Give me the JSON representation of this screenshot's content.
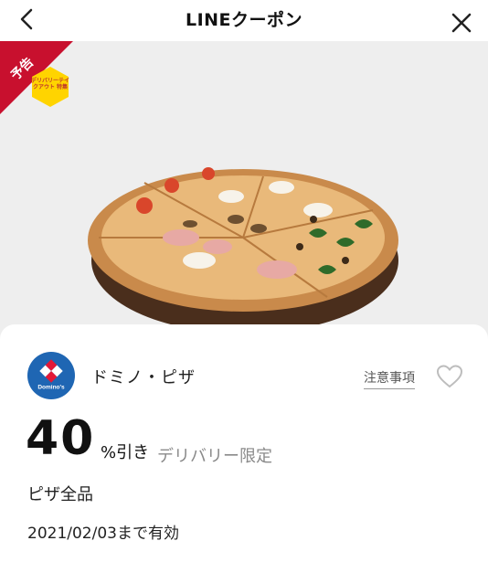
{
  "header": {
    "title": "LINEクーポン"
  },
  "hero": {
    "ribbon_label": "予告",
    "badge_label": "デリバリーテイクアウト 特集"
  },
  "coupon": {
    "merchant": "ドミノ・ピザ",
    "notes_link": "注意事項",
    "discount_value": "40",
    "discount_unit": "%引き",
    "discount_scope": "デリバリー限定",
    "target": "ピザ全品",
    "validity": "2021/02/03まで有効"
  },
  "icons": {
    "back": "chevron-left-icon",
    "close": "close-icon",
    "favorite": "heart-icon",
    "logo": "dominos-logo"
  },
  "colors": {
    "ribbon": "#c8102e",
    "badge": "#ffd400",
    "logo_blue": "#1f66b3"
  }
}
